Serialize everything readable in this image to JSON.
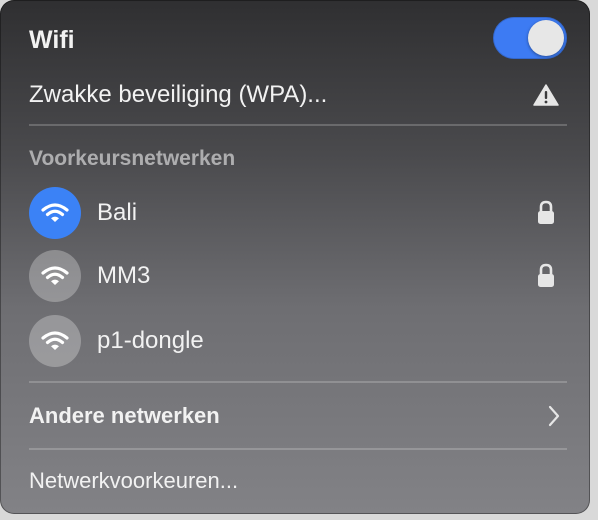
{
  "header": {
    "title": "Wifi",
    "toggle_on": true
  },
  "warning": {
    "label": "Zwakke beveiliging (WPA)...",
    "icon": "warning-triangle-icon"
  },
  "preferred": {
    "section_label": "Voorkeursnetwerken",
    "networks": [
      {
        "name": "Bali",
        "connected": true,
        "secured": true
      },
      {
        "name": "MM3",
        "connected": false,
        "secured": true
      },
      {
        "name": "p1-dongle",
        "connected": false,
        "secured": false
      }
    ]
  },
  "other": {
    "label": "Andere netwerken"
  },
  "preferences": {
    "label": "Netwerkvoorkeuren..."
  },
  "colors": {
    "accent": "#3b82f6",
    "toggle": "#3d7bf3"
  }
}
